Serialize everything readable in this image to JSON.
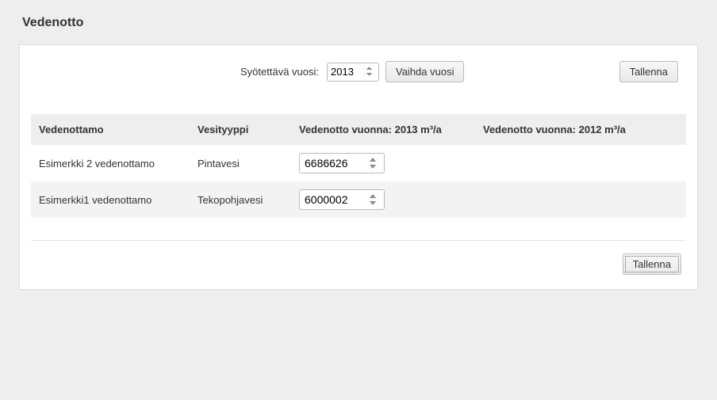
{
  "page_title": "Vedenotto",
  "top": {
    "year_label": "Syötettävä vuosi:",
    "year_value": "2013",
    "change_year_label": "Vaihda vuosi",
    "save_label": "Tallenna"
  },
  "table": {
    "headers": {
      "station": "Vedenottamo",
      "water_type": "Vesityyppi",
      "current": "Vedenotto vuonna: 2013 m³/a",
      "previous": "Vedenotto vuonna: 2012 m³/a"
    },
    "rows": [
      {
        "station": "Esimerkki 2 vedenottamo",
        "water_type": "Pintavesi",
        "current_value": "6686626",
        "previous_value": ""
      },
      {
        "station": "Esimerkki1 vedenottamo",
        "water_type": "Tekopohjavesi",
        "current_value": "6000002",
        "previous_value": ""
      }
    ]
  },
  "bottom": {
    "save_label": "Tallenna"
  }
}
